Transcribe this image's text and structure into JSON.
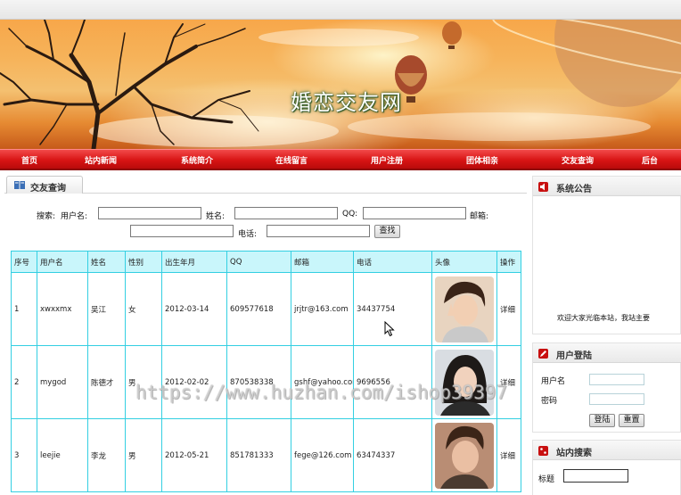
{
  "site": {
    "title": "婚恋交友网"
  },
  "nav": [
    "首页",
    "站内新闻",
    "系统简介",
    "在线留言",
    "用户注册",
    "团体相亲",
    "交友查询",
    "后台"
  ],
  "panel": {
    "title": "交友查询"
  },
  "search": {
    "label": "搜索:",
    "username_label": "用户名:",
    "name_label": "姓名:",
    "qq_label": "QQ:",
    "email_label": "邮箱:",
    "phone_label": "电话:",
    "button": "查找",
    "values": {
      "username": "",
      "name": "",
      "qq": "",
      "email": "",
      "phone": ""
    }
  },
  "table": {
    "headers": [
      "序号",
      "用户名",
      "姓名",
      "性别",
      "出生年月",
      "QQ",
      "邮箱",
      "电话",
      "头像",
      "操作"
    ],
    "rows": [
      {
        "no": "1",
        "username": "xwxxmx",
        "name": "吴江",
        "gender": "女",
        "birth": "2012-03-14",
        "qq": "609577618",
        "email": "jrjtr@163.com",
        "phone": "34437754",
        "action": "详细"
      },
      {
        "no": "2",
        "username": "mygod",
        "name": "陈德才",
        "gender": "男",
        "birth": "2012-02-02",
        "qq": "870538338",
        "email": "gshf@yahoo.com",
        "phone": "9696556",
        "action": "详细"
      },
      {
        "no": "3",
        "username": "leejie",
        "name": "李龙",
        "gender": "男",
        "birth": "2012-05-21",
        "qq": "851781333",
        "email": "fege@126.com",
        "phone": "63474337",
        "action": "详细"
      }
    ]
  },
  "sidebar": {
    "notice": {
      "title": "系统公告",
      "text": "欢迎大家光临本站，我站主要"
    },
    "login": {
      "title": "用户登陆",
      "username_label": "用户名",
      "password_label": "密码",
      "login_button": "登陆",
      "reset_button": "重置"
    },
    "site_search": {
      "title": "站内搜索",
      "title_label": "标题"
    }
  },
  "watermark": "https://www.huzhan.com/ishop39397",
  "colors": {
    "nav": "#d81414",
    "table_border": "#33cfe2",
    "table_header": "#c9f6fb"
  }
}
